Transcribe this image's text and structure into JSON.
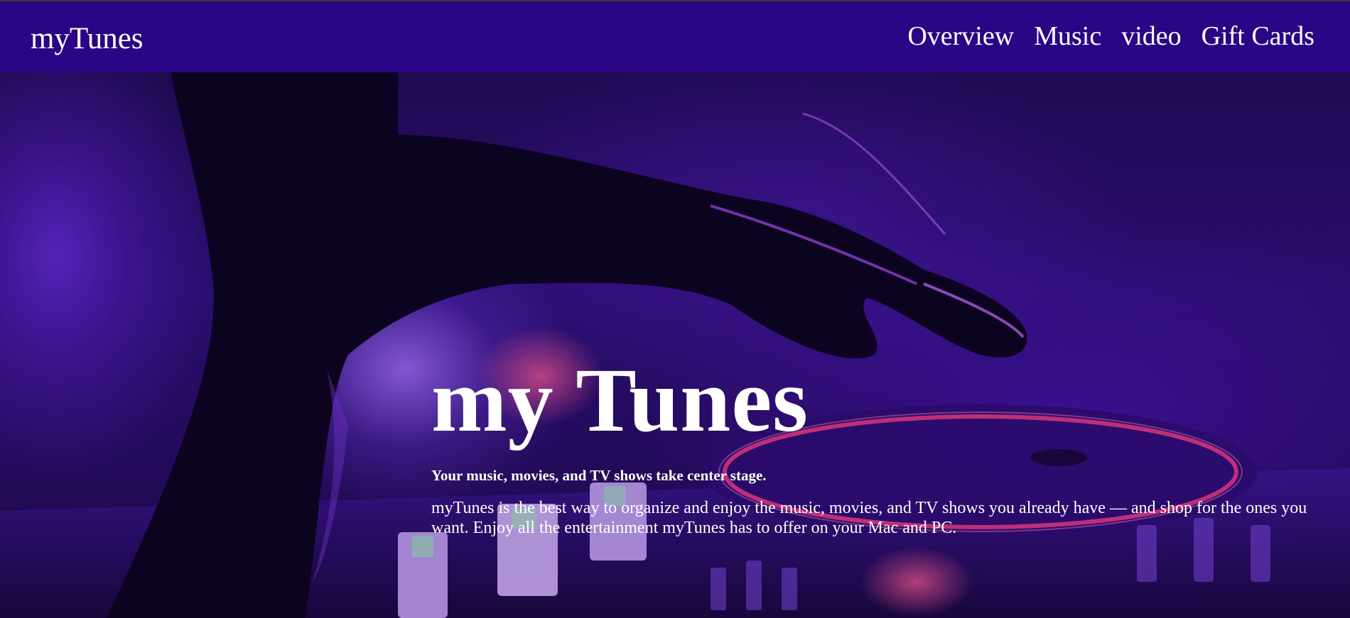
{
  "navbar": {
    "brand": "myTunes",
    "links": [
      {
        "label": "Overview"
      },
      {
        "label": "Music"
      },
      {
        "label": "video"
      },
      {
        "label": "Gift Cards"
      }
    ],
    "background_color": "#2a0585"
  },
  "hero": {
    "title": "my Tunes",
    "subtitle": "Your music, movies, and TV shows take center stage.",
    "body": "myTunes is the best way to organize and enjoy the music, movies, and TV shows you already have — and shop for the ones you want. Enjoy all the entertainment myTunes has to offer on your Mac and PC.",
    "text_color": "#ffffff"
  }
}
